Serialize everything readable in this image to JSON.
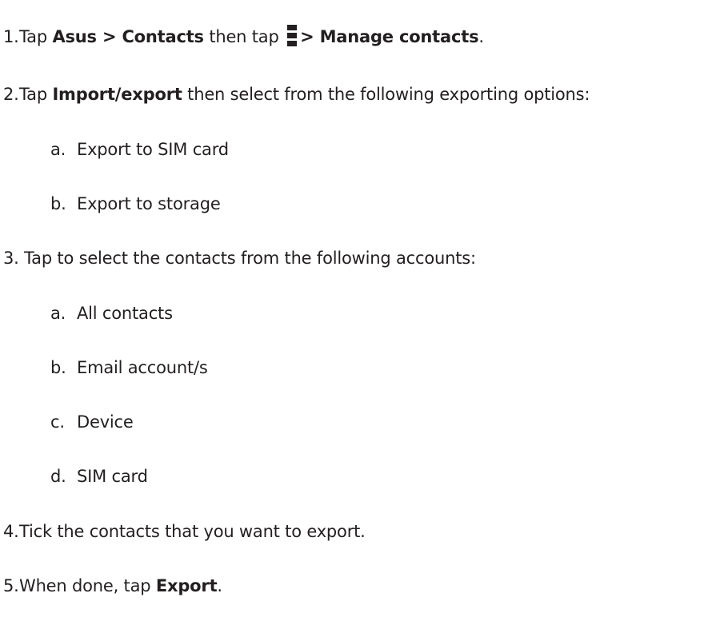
{
  "steps": [
    {
      "num": "1.",
      "parts": {
        "t1": "Tap ",
        "b1": "Asus > Contacts",
        "t2": " then tap ",
        "icon": "more-vertical-icon",
        "b2": "> Manage contacts",
        "t3": "."
      }
    },
    {
      "num": "2.",
      "parts": {
        "t1": "Tap ",
        "b1": "Import/export",
        "t2": " then select from the following exporting options:"
      },
      "subs": [
        {
          "num": "a.",
          "text": "Export to SIM card"
        },
        {
          "num": "b.",
          "text": "Export to storage"
        }
      ]
    },
    {
      "num": "3.",
      "parts": {
        "t1": "Tap to select the contacts from the following accounts:"
      },
      "subs": [
        {
          "num": "a.",
          "text": "All contacts"
        },
        {
          "num": "b.",
          "text": "Email account/s"
        },
        {
          "num": "c.",
          "text": "Device"
        },
        {
          "num": "d.",
          "text": "SIM card"
        }
      ]
    },
    {
      "num": "4.",
      "parts": {
        "t1": "Tick the contacts that you want to export."
      }
    },
    {
      "num": "5.",
      "parts": {
        "t1": "When done, tap ",
        "b1": "Export",
        "t2": "."
      }
    }
  ]
}
